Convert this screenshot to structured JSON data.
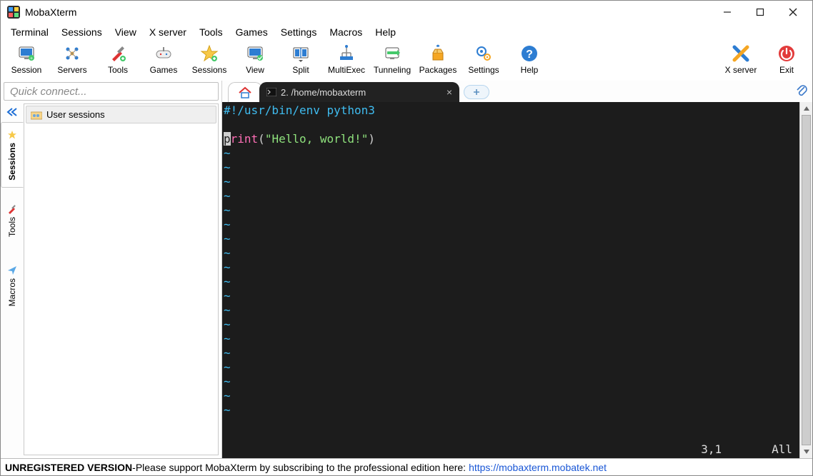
{
  "window": {
    "title": "MobaXterm"
  },
  "menu": {
    "items": [
      "Terminal",
      "Sessions",
      "View",
      "X server",
      "Tools",
      "Games",
      "Settings",
      "Macros",
      "Help"
    ]
  },
  "toolbar": {
    "left": [
      "Session",
      "Servers",
      "Tools",
      "Games",
      "Sessions",
      "View",
      "Split",
      "MultiExec",
      "Tunneling",
      "Packages",
      "Settings",
      "Help"
    ],
    "right": [
      "X server",
      "Exit"
    ]
  },
  "quickconnect": {
    "placeholder": "Quick connect..."
  },
  "sidetabs": {
    "items": [
      "Sessions",
      "Tools",
      "Macros"
    ],
    "active": 0
  },
  "tree": {
    "root_label": "User sessions"
  },
  "tabs": {
    "home_name": "home-tab",
    "terminal": {
      "label": "2. /home/mobaxterm"
    }
  },
  "terminal": {
    "shebang": "#!/usr/bin/env python3",
    "code": {
      "cursor_char": "p",
      "rest": "rint",
      "open": "(",
      "quote1": "\"",
      "string": "Hello, world!",
      "quote2": "\"",
      "close": ")"
    },
    "tilde": "~",
    "status_pos": "3,1",
    "status_scope": "All"
  },
  "footer": {
    "unreg": "UNREGISTERED VERSION",
    "sep": "  -  ",
    "msg": "Please support MobaXterm by subscribing to the professional edition here:  ",
    "link": "https://mobaxterm.mobatek.net"
  }
}
